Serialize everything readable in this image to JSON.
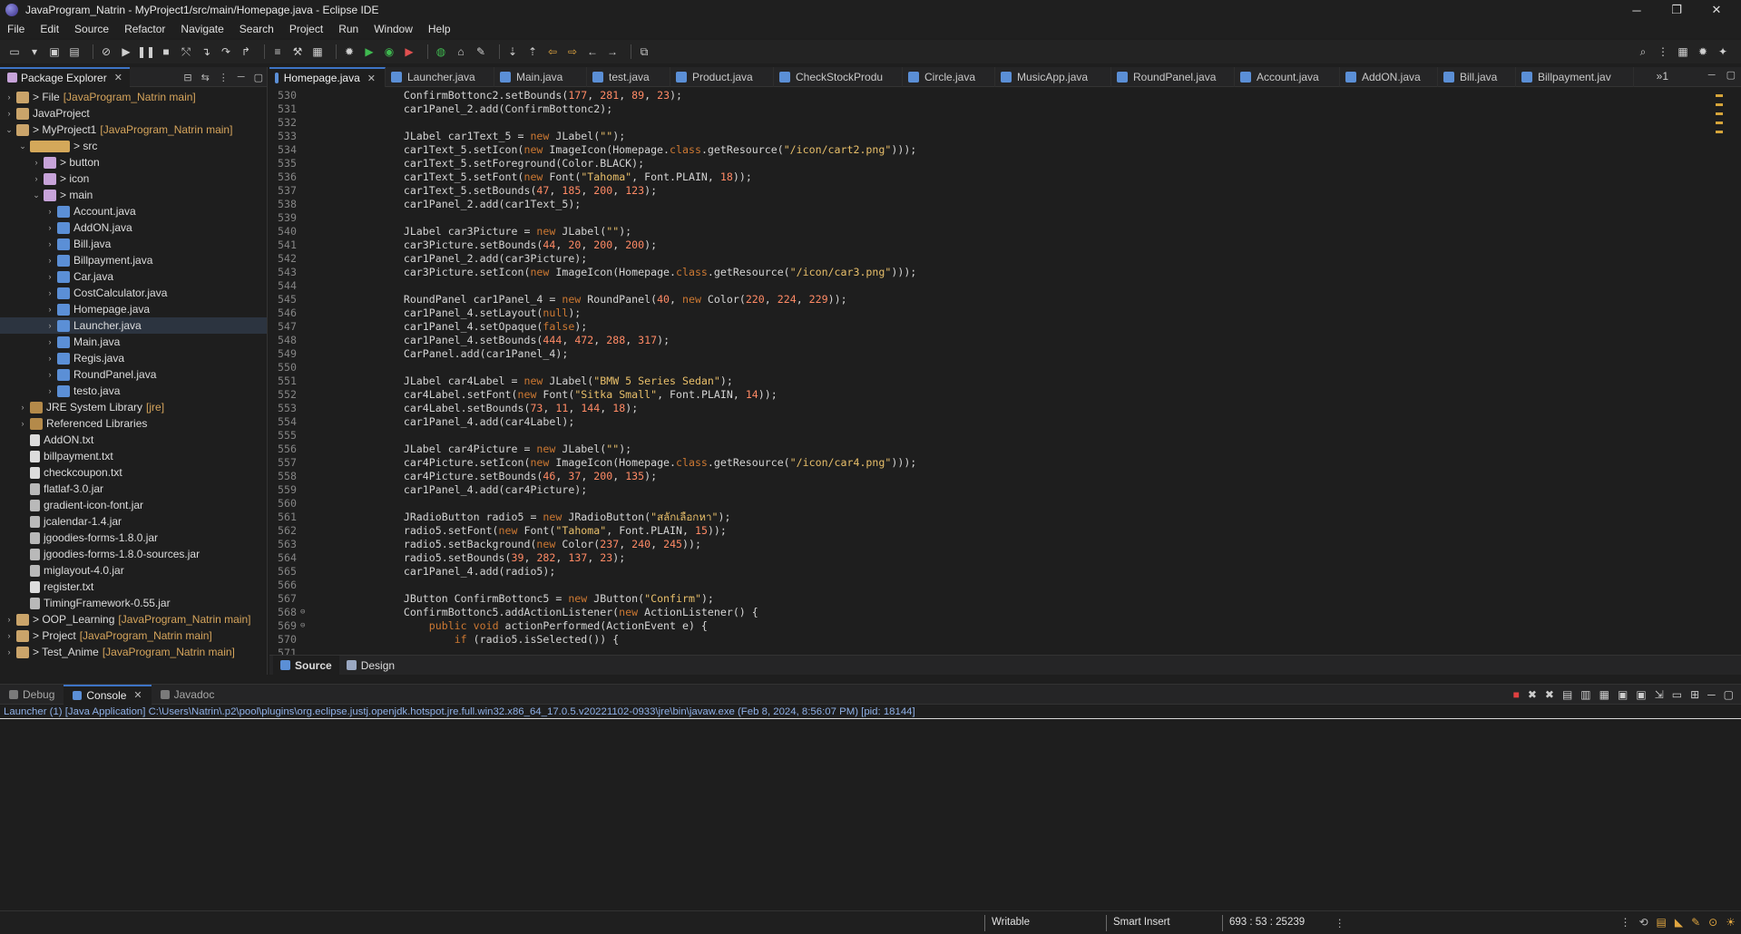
{
  "window": {
    "title": "JavaProgram_Natrin - MyProject1/src/main/Homepage.java - Eclipse IDE",
    "controls": [
      "─",
      "❐",
      "✕"
    ]
  },
  "menu": [
    "File",
    "Edit",
    "Source",
    "Refactor",
    "Navigate",
    "Search",
    "Project",
    "Run",
    "Window",
    "Help"
  ],
  "package_explorer": {
    "title": "Package Explorer",
    "tree": [
      {
        "depth": 0,
        "tw": "›",
        "icon": "proj",
        "label": "> File",
        "decor": "[JavaProgram_Natrin main]"
      },
      {
        "depth": 0,
        "tw": "›",
        "icon": "proj",
        "label": "JavaProject",
        "decor": ""
      },
      {
        "depth": 0,
        "tw": "⌄",
        "icon": "proj",
        "label": "> MyProject1",
        "decor": "[JavaProgram_Natrin main]"
      },
      {
        "depth": 1,
        "tw": "⌄",
        "icon": "src",
        "label": "> src",
        "decor": ""
      },
      {
        "depth": 2,
        "tw": "›",
        "icon": "pkgf",
        "label": "> button",
        "decor": ""
      },
      {
        "depth": 2,
        "tw": "›",
        "icon": "pkgf",
        "label": "> icon",
        "decor": ""
      },
      {
        "depth": 2,
        "tw": "⌄",
        "icon": "pkgf",
        "label": "> main",
        "decor": ""
      },
      {
        "depth": 3,
        "tw": "›",
        "icon": "java",
        "label": "Account.java",
        "decor": ""
      },
      {
        "depth": 3,
        "tw": "›",
        "icon": "java",
        "label": "AddON.java",
        "decor": ""
      },
      {
        "depth": 3,
        "tw": "›",
        "icon": "java",
        "label": "Bill.java",
        "decor": ""
      },
      {
        "depth": 3,
        "tw": "›",
        "icon": "java",
        "label": "Billpayment.java",
        "decor": ""
      },
      {
        "depth": 3,
        "tw": "›",
        "icon": "java",
        "label": "Car.java",
        "decor": ""
      },
      {
        "depth": 3,
        "tw": "›",
        "icon": "java",
        "label": "CostCalculator.java",
        "decor": ""
      },
      {
        "depth": 3,
        "tw": "›",
        "icon": "java",
        "label": "Homepage.java",
        "decor": ""
      },
      {
        "depth": 3,
        "tw": "›",
        "icon": "java",
        "label": "Launcher.java",
        "decor": "",
        "selected": true
      },
      {
        "depth": 3,
        "tw": "›",
        "icon": "java",
        "label": "Main.java",
        "decor": ""
      },
      {
        "depth": 3,
        "tw": "›",
        "icon": "java",
        "label": "Regis.java",
        "decor": ""
      },
      {
        "depth": 3,
        "tw": "›",
        "icon": "java",
        "label": "RoundPanel.java",
        "decor": ""
      },
      {
        "depth": 3,
        "tw": "›",
        "icon": "java",
        "label": "testo.java",
        "decor": ""
      },
      {
        "depth": 1,
        "tw": "›",
        "icon": "lib",
        "label": "JRE System Library",
        "decor": "[jre]"
      },
      {
        "depth": 1,
        "tw": "›",
        "icon": "lib",
        "label": "Referenced Libraries",
        "decor": ""
      },
      {
        "depth": 1,
        "tw": "",
        "icon": "file",
        "label": "AddON.txt",
        "decor": ""
      },
      {
        "depth": 1,
        "tw": "",
        "icon": "file",
        "label": "billpayment.txt",
        "decor": ""
      },
      {
        "depth": 1,
        "tw": "",
        "icon": "file",
        "label": "checkcoupon.txt",
        "decor": ""
      },
      {
        "depth": 1,
        "tw": "",
        "icon": "jar",
        "label": "flatlaf-3.0.jar",
        "decor": ""
      },
      {
        "depth": 1,
        "tw": "",
        "icon": "jar",
        "label": "gradient-icon-font.jar",
        "decor": ""
      },
      {
        "depth": 1,
        "tw": "",
        "icon": "jar",
        "label": "jcalendar-1.4.jar",
        "decor": ""
      },
      {
        "depth": 1,
        "tw": "",
        "icon": "jar",
        "label": "jgoodies-forms-1.8.0.jar",
        "decor": ""
      },
      {
        "depth": 1,
        "tw": "",
        "icon": "jar",
        "label": "jgoodies-forms-1.8.0-sources.jar",
        "decor": ""
      },
      {
        "depth": 1,
        "tw": "",
        "icon": "jar",
        "label": "miglayout-4.0.jar",
        "decor": ""
      },
      {
        "depth": 1,
        "tw": "",
        "icon": "file",
        "label": "register.txt",
        "decor": ""
      },
      {
        "depth": 1,
        "tw": "",
        "icon": "jar",
        "label": "TimingFramework-0.55.jar",
        "decor": ""
      },
      {
        "depth": 0,
        "tw": "›",
        "icon": "proj",
        "label": "> OOP_Learning",
        "decor": "[JavaProgram_Natrin main]"
      },
      {
        "depth": 0,
        "tw": "›",
        "icon": "proj",
        "label": "> Project",
        "decor": "[JavaProgram_Natrin main]"
      },
      {
        "depth": 0,
        "tw": "›",
        "icon": "proj",
        "label": "> Test_Anime",
        "decor": "[JavaProgram_Natrin main]"
      }
    ]
  },
  "editor": {
    "tabs": [
      {
        "label": "Homepage.java",
        "active": true,
        "width": 128
      },
      {
        "label": "Launcher.java",
        "active": false,
        "width": 120
      },
      {
        "label": "Main.java",
        "active": false,
        "width": 102
      },
      {
        "label": "test.java",
        "active": false,
        "width": 92
      },
      {
        "label": "Product.java",
        "active": false,
        "width": 114
      },
      {
        "label": "CheckStockProdu",
        "active": false,
        "width": 142
      },
      {
        "label": "Circle.java",
        "active": false,
        "width": 102
      },
      {
        "label": "MusicApp.java",
        "active": false,
        "width": 128
      },
      {
        "label": "RoundPanel.java",
        "active": false,
        "width": 136
      },
      {
        "label": "Account.java",
        "active": false,
        "width": 116
      },
      {
        "label": "AddON.java",
        "active": false,
        "width": 108
      },
      {
        "label": "Bill.java",
        "active": false,
        "width": 86
      },
      {
        "label": "Billpayment.jav",
        "active": false,
        "width": 130
      }
    ],
    "overflow_label": "»1",
    "code": [
      {
        "n": "530",
        "t": "        ConfirmBottonc2.setBounds(177, 281, 89, 23);"
      },
      {
        "n": "531",
        "t": "        car1Panel_2.add(ConfirmBottonc2);"
      },
      {
        "n": "532",
        "t": ""
      },
      {
        "n": "533",
        "t": "        JLabel car1Text_5 = new JLabel(\"\");"
      },
      {
        "n": "534",
        "t": "        car1Text_5.setIcon(new ImageIcon(Homepage.class.getResource(\"/icon/cart2.png\")));"
      },
      {
        "n": "535",
        "t": "        car1Text_5.setForeground(Color.BLACK);"
      },
      {
        "n": "536",
        "t": "        car1Text_5.setFont(new Font(\"Tahoma\", Font.PLAIN, 18));"
      },
      {
        "n": "537",
        "t": "        car1Text_5.setBounds(47, 185, 200, 123);"
      },
      {
        "n": "538",
        "t": "        car1Panel_2.add(car1Text_5);"
      },
      {
        "n": "539",
        "t": ""
      },
      {
        "n": "540",
        "t": "        JLabel car3Picture = new JLabel(\"\");"
      },
      {
        "n": "541",
        "t": "        car3Picture.setBounds(44, 20, 200, 200);"
      },
      {
        "n": "542",
        "t": "        car1Panel_2.add(car3Picture);"
      },
      {
        "n": "543",
        "t": "        car3Picture.setIcon(new ImageIcon(Homepage.class.getResource(\"/icon/car3.png\")));"
      },
      {
        "n": "544",
        "t": ""
      },
      {
        "n": "545",
        "t": "        RoundPanel car1Panel_4 = new RoundPanel(40, new Color(220, 224, 229));"
      },
      {
        "n": "546",
        "t": "        car1Panel_4.setLayout(null);"
      },
      {
        "n": "547",
        "t": "        car1Panel_4.setOpaque(false);"
      },
      {
        "n": "548",
        "t": "        car1Panel_4.setBounds(444, 472, 288, 317);"
      },
      {
        "n": "549",
        "t": "        CarPanel.add(car1Panel_4);"
      },
      {
        "n": "550",
        "t": ""
      },
      {
        "n": "551",
        "t": "        JLabel car4Label = new JLabel(\"BMW 5 Series Sedan\");"
      },
      {
        "n": "552",
        "t": "        car4Label.setFont(new Font(\"Sitka Small\", Font.PLAIN, 14));"
      },
      {
        "n": "553",
        "t": "        car4Label.setBounds(73, 11, 144, 18);"
      },
      {
        "n": "554",
        "t": "        car1Panel_4.add(car4Label);"
      },
      {
        "n": "555",
        "t": ""
      },
      {
        "n": "556",
        "t": "        JLabel car4Picture = new JLabel(\"\");"
      },
      {
        "n": "557",
        "t": "        car4Picture.setIcon(new ImageIcon(Homepage.class.getResource(\"/icon/car4.png\")));"
      },
      {
        "n": "558",
        "t": "        car4Picture.setBounds(46, 37, 200, 135);"
      },
      {
        "n": "559",
        "t": "        car1Panel_4.add(car4Picture);"
      },
      {
        "n": "560",
        "t": ""
      },
      {
        "n": "561",
        "t": "        JRadioButton radio5 = new JRadioButton(\"สลักเลือกหา\");"
      },
      {
        "n": "562",
        "t": "        radio5.setFont(new Font(\"Tahoma\", Font.PLAIN, 15));"
      },
      {
        "n": "563",
        "t": "        radio5.setBackground(new Color(237, 240, 245));"
      },
      {
        "n": "564",
        "t": "        radio5.setBounds(39, 282, 137, 23);"
      },
      {
        "n": "565",
        "t": "        car1Panel_4.add(radio5);"
      },
      {
        "n": "566",
        "t": ""
      },
      {
        "n": "567",
        "t": "        JButton ConfirmBottonc5 = new JButton(\"Confirm\");"
      },
      {
        "n": "568",
        "t": "        ConfirmBottonc5.addActionListener(new ActionListener() {",
        "g": "⊖"
      },
      {
        "n": "569",
        "t": "            public void actionPerformed(ActionEvent e) {",
        "g": "⊖"
      },
      {
        "n": "570",
        "t": "                if (radio5.isSelected()) {"
      },
      {
        "n": "571",
        "t": ""
      }
    ],
    "source_tab": "Source",
    "design_tab": "Design"
  },
  "bottom_panel": {
    "tabs": [
      {
        "label": "Debug",
        "active": false
      },
      {
        "label": "Console",
        "active": true
      },
      {
        "label": "Javadoc",
        "active": false
      }
    ],
    "console_status": "Launcher (1) [Java Application] C:\\Users\\Natrin\\.p2\\pool\\plugins\\org.eclipse.justj.openjdk.hotspot.jre.full.win32.x86_64_17.0.5.v20221102-0933\\jre\\bin\\javaw.exe  (Feb 8, 2024, 8:56:07 PM) [pid: 18144]"
  },
  "status_bar": {
    "writable": "Writable",
    "insert_mode": "Smart Insert",
    "position": "693 : 53 : 25239"
  },
  "colors": {
    "accent": "#3d74c6",
    "keyword": "#cc7832",
    "string": "#e8bf6a",
    "number": "#ff8a65",
    "field": "#9b6cf0"
  }
}
